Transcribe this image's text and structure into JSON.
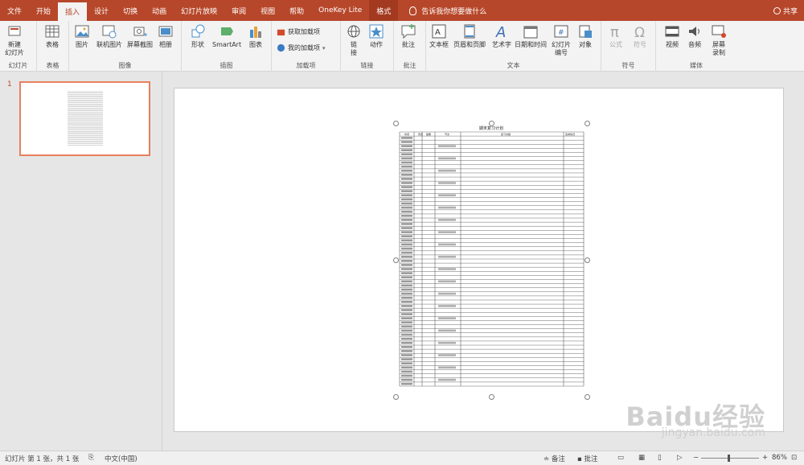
{
  "tabs": [
    "文件",
    "开始",
    "插入",
    "设计",
    "切换",
    "动画",
    "幻灯片放映",
    "审阅",
    "视图",
    "帮助",
    "OneKey Lite",
    "格式"
  ],
  "active_tab": "插入",
  "tell_me": "告诉我你想要做什么",
  "share": "共享",
  "ribbon": {
    "slides": {
      "label": "幻灯片",
      "new_slide": "新建\n幻灯片"
    },
    "tables": {
      "label": "表格",
      "table": "表格"
    },
    "images": {
      "label": "图像",
      "picture": "图片",
      "online_picture": "联机图片",
      "screenshot": "屏幕截图",
      "album": "相册"
    },
    "illustrations": {
      "label": "插图",
      "shapes": "形状",
      "smartart": "SmartArt",
      "chart": "图表"
    },
    "addins": {
      "label": "加载项",
      "get_addins": "获取加载项",
      "my_addins": "我的加载项"
    },
    "links": {
      "label": "链接",
      "link": "链\n接",
      "action": "动作"
    },
    "comments": {
      "label": "批注",
      "comment": "批注"
    },
    "text": {
      "label": "文本",
      "textbox": "文本框",
      "header_footer": "页眉和页脚",
      "wordart": "艺术字",
      "datetime": "日期和时间",
      "slide_number": "幻灯片\n编号",
      "object": "对象"
    },
    "symbols": {
      "label": "符号",
      "equation": "公式",
      "symbol": "符号"
    },
    "media": {
      "label": "媒体",
      "video": "视频",
      "audio": "音频",
      "screen_recording": "屏幕\n录制"
    }
  },
  "thumbnail": {
    "slide_number": "1"
  },
  "document": {
    "title": "期末复习计划",
    "columns": [
      "时间",
      "周次",
      "星期",
      "节次",
      "复习内容",
      "完成情况"
    ]
  },
  "status": {
    "slide_info": "幻灯片 第 1 张，共 1 张",
    "language": "中文(中国)",
    "notes": "备注",
    "comments": "批注",
    "zoom": "86%"
  },
  "watermark": {
    "brand": "Baidu经验",
    "url": "jingyan.baidu.com"
  },
  "colors": {
    "accent": "#b7472a",
    "thumb_border": "#e8805f"
  }
}
